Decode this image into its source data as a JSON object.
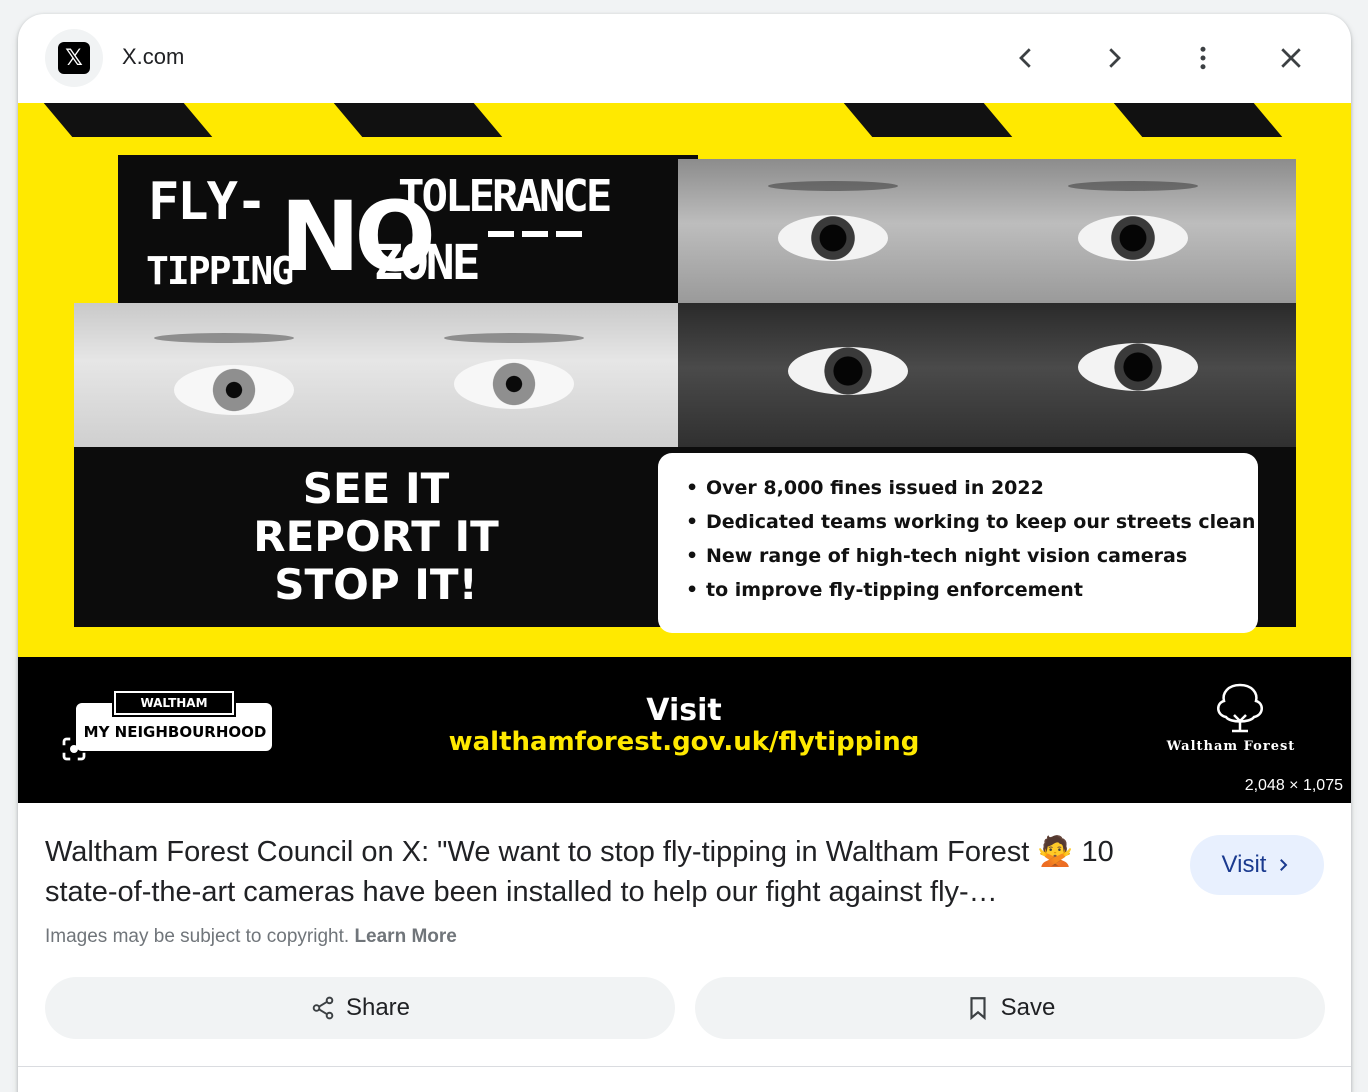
{
  "header": {
    "site_logo_text": "𝕏",
    "site_name": "X.com",
    "icons": [
      "x-logo-icon",
      "chevron-left-icon",
      "chevron-right-icon",
      "more-vert-icon",
      "close-icon"
    ]
  },
  "image": {
    "title_fly": "FLY-",
    "title_tipping": "TIPPING",
    "title_no": "NO",
    "title_tolerance": "TOLERANCE",
    "title_zone": "ZONE",
    "slogan": [
      "SEE IT",
      "REPORT IT",
      "STOP IT!"
    ],
    "bullets": [
      "Over 8,000 fines issued in 2022",
      "Dedicated teams working to keep our streets clean",
      "New range of high-tech night vision cameras",
      "to improve fly-tipping enforcement"
    ],
    "badge_top": "WALTHAM FOREST",
    "badge_bottom": "MY NEIGHBOURHOOD",
    "visit_label": "Visit",
    "url": "walthamforest.gov.uk/flytipping",
    "council_name": "Waltham Forest",
    "dimensions": "2,048 × 1,075",
    "colors": {
      "yellow": "#ffe900",
      "black": "#000000"
    }
  },
  "caption": {
    "text": "Waltham Forest Council on X: \"We want to stop fly-tipping in Waltham Forest 🙅 10 state-of-the-art cameras have been installed to help our fight against fly-…",
    "visit_label": "Visit",
    "copyright_text": "Images may be subject to copyright.",
    "learn_more": "Learn More"
  },
  "actions": {
    "share_label": "Share",
    "save_label": "Save"
  }
}
